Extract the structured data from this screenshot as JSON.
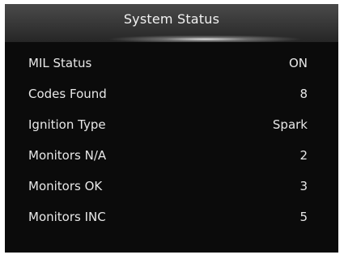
{
  "header": {
    "title": "System Status"
  },
  "status": {
    "rows": [
      {
        "label": "MIL Status",
        "value": "ON"
      },
      {
        "label": "Codes Found",
        "value": "8"
      },
      {
        "label": "Ignition Type",
        "value": "Spark"
      },
      {
        "label": "Monitors N/A",
        "value": "2"
      },
      {
        "label": "Monitors OK",
        "value": "3"
      },
      {
        "label": "Monitors INC",
        "value": "5"
      }
    ]
  }
}
